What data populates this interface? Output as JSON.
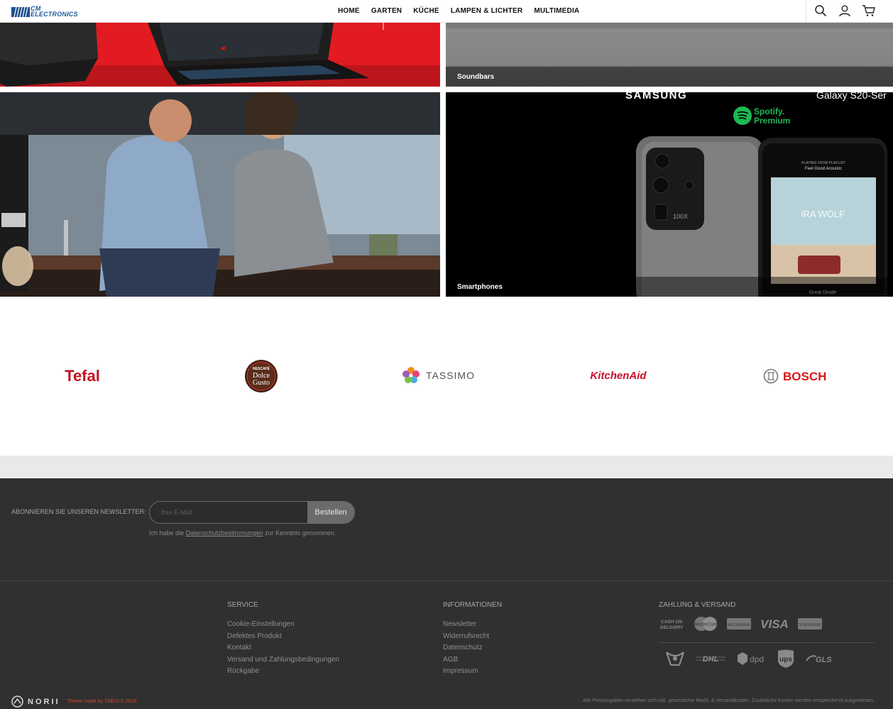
{
  "header": {
    "logo_line1": "CM",
    "logo_line2": "ELECTRONICS",
    "nav": [
      "HOME",
      "GARTEN",
      "KÜCHE",
      "LAMPEN & LICHTER",
      "MULTIMEDIA"
    ]
  },
  "banners": {
    "soundbars": "Soundbars",
    "smartphones": "Smartphones",
    "samsung": "SAMSUNG",
    "galaxy": "Galaxy S20-Ser",
    "spotify_line1": "Spotify.",
    "spotify_line2": "Premium",
    "playing_from": "PLAYING FROM PLAYLIST",
    "playlist": "Feel Good Acoustic",
    "album": "IRA WOLF",
    "song": "Great Divide",
    "zoom": "100X"
  },
  "brands": {
    "tefal": "Tefal",
    "nescafe": "NESCAFÉ",
    "dolce": "Dolce",
    "gusto": "Gusto",
    "tassimo": "TASSIMO",
    "kitchenaid": "KitchenAid",
    "bosch": "BOSCH"
  },
  "newsletter": {
    "label": "ABONNIEREN SIE UNSEREN NEWSLETTER:",
    "placeholder": "Ihre E-Mail",
    "button": "Bestellen",
    "note_before": "Ich habe die",
    "note_link": "Datenschutzbestimmungen",
    "note_after": "zur Kenntnis genommen."
  },
  "footer": {
    "service": {
      "title": "SERVICE",
      "items": [
        "Cookie-Einstellungen",
        "Defektes Produkt",
        "Kontakt",
        "Versand und Zahlungsbedingungen",
        "Rückgabe"
      ]
    },
    "info": {
      "title": "INFORMATIONEN",
      "items": [
        "Newsletter",
        "Widerrufsrecht",
        "Datenschutz",
        "AGB",
        "Impressum"
      ]
    },
    "payment": {
      "title": "ZAHLUNG & VERSAND",
      "cash_line1": "CASH ON",
      "cash_line2": "DELIVERY",
      "mastercard": "MasterCard",
      "rechnung": "RECHNUNG",
      "visa": "VISA",
      "vorkasse": "VORKASSE",
      "dhl": "DHL",
      "dpd": "dpd",
      "ups": "ups",
      "gls": "GLS"
    },
    "brand": "NORII",
    "theme_credit": "Theme made by TAB10 © 2016",
    "legal": "Alle Preisangaben verstehen sich inkl. gesetzlicher MwSt. & Versandkosten. Zusätzliche Kosten werden entsprechend ausgewiesen."
  }
}
